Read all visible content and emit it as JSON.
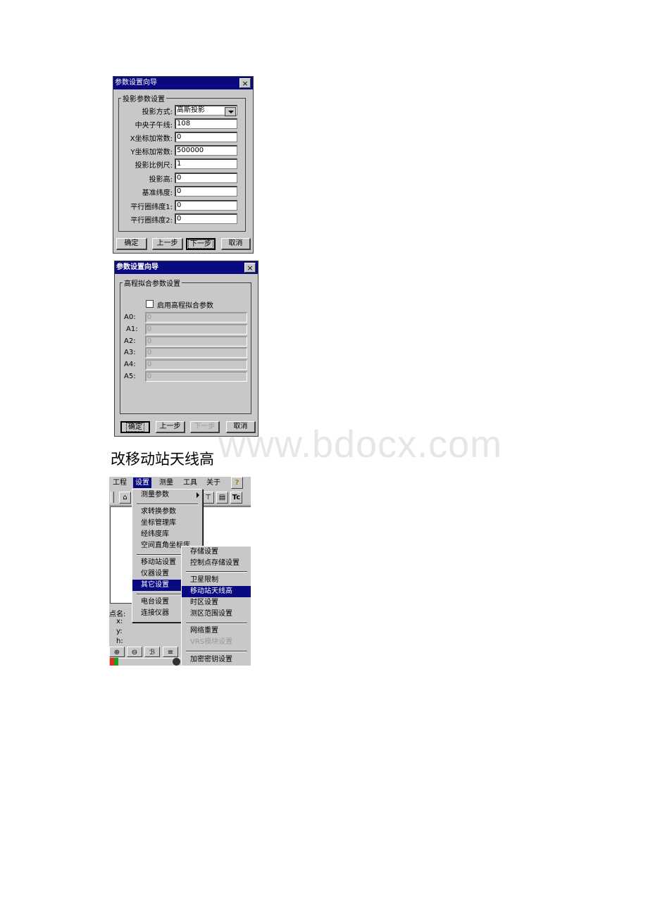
{
  "watermark": "www.bdocx.com",
  "caption": "改移动站天线高",
  "dialog1": {
    "title": "参数设置向导",
    "close": "×",
    "group": "投影参数设置",
    "fields": [
      {
        "label": "投影方式:",
        "value": "高斯投影",
        "type": "select"
      },
      {
        "label": "中央子午线:",
        "value": "108"
      },
      {
        "label": "X坐标加常数:",
        "value": "0"
      },
      {
        "label": "Y坐标加常数:",
        "value": "500000"
      },
      {
        "label": "投影比例尺:",
        "value": "1"
      },
      {
        "label": "投影高:",
        "value": "0"
      },
      {
        "label": "基准纬度:",
        "value": "0"
      },
      {
        "label": "平行圈纬度1:",
        "value": "0"
      },
      {
        "label": "平行圈纬度2:",
        "value": "0"
      }
    ],
    "buttons": {
      "ok": "确定",
      "prev": "上一步",
      "next": "下一步",
      "cancel": "取消"
    }
  },
  "dialog2": {
    "title": "参数设置向导",
    "close": "×",
    "group": "高程拟合参数设置",
    "checkbox_label": "启用高程拟合参数",
    "checkbox_checked": false,
    "fields": [
      {
        "label": "A0:",
        "value": "0"
      },
      {
        "label": "A1:",
        "value": "0"
      },
      {
        "label": "A2:",
        "value": "0"
      },
      {
        "label": "A3:",
        "value": "0"
      },
      {
        "label": "A4:",
        "value": "0"
      },
      {
        "label": "A5:",
        "value": "0"
      }
    ],
    "buttons": {
      "ok": "确定",
      "prev": "上一步",
      "next": "下一步",
      "cancel": "取消"
    }
  },
  "app": {
    "menubar": [
      "工程",
      "设置",
      "测量",
      "工具",
      "关于"
    ],
    "active_menu": "设置",
    "help_icon": "?",
    "settings_menu": {
      "items": [
        "测量参数",
        "求转换参数",
        "坐标管理库",
        "经纬度库",
        "空间直角坐标库",
        "移动站设置",
        "仪器设置",
        "其它设置",
        "电台设置",
        "连接仪器"
      ],
      "active": "其它设置"
    },
    "other_submenu": {
      "items": [
        "存储设置",
        "控制点存储设置",
        "卫星限制",
        "移动站天线高",
        "时区设置",
        "测区范围设置",
        "网络重置",
        "VRS模块设置",
        "加密密钥设置"
      ],
      "active": "移动站天线高",
      "disabled": [
        "VRS模块设置"
      ]
    },
    "point_labels": {
      "name": "点名:",
      "x": "x:",
      "y": "y:",
      "h": "h:"
    }
  }
}
